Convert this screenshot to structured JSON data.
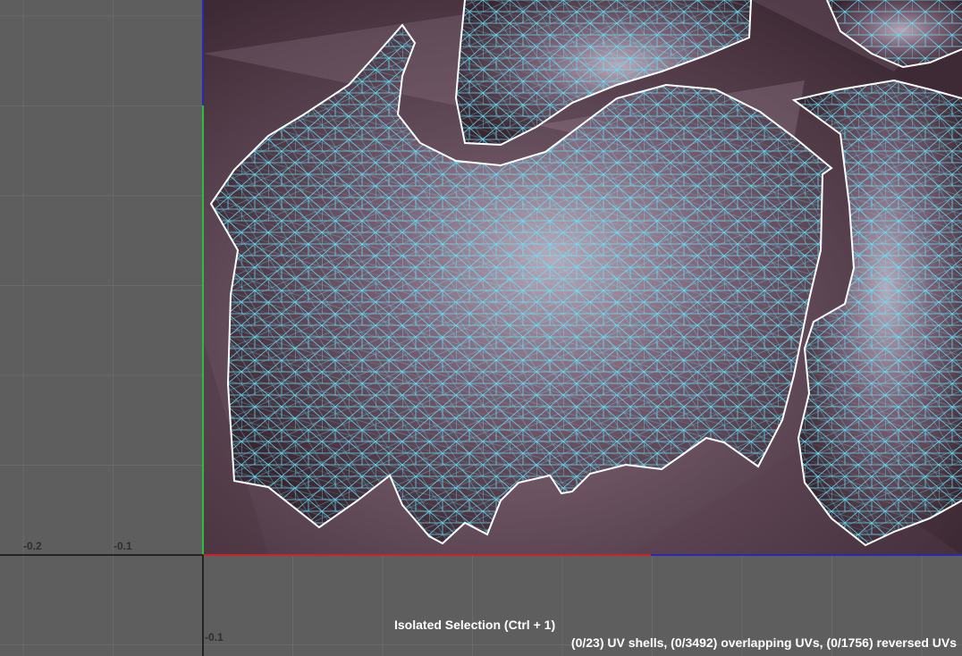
{
  "viewport": {
    "grid_color": "#6a6a6a",
    "background_color": "#5e5e5e",
    "axis_u_color": "#d0202a",
    "axis_v_color": "#2bbf3a",
    "texture_edge_color": "#2a2ab0",
    "shell_border_color": "#ffffff",
    "wire_color": "#64e6ff",
    "texture_color_dark": "#3b2630",
    "texture_color_mid": "#6e5565",
    "texture_color_light": "#b8a8b8"
  },
  "axis_labels": {
    "u_minus_02": "-0.2",
    "u_minus_01": "-0.1",
    "v_minus_01": "-0.1"
  },
  "status": {
    "isolate_hint": "Isolated Selection (Ctrl + 1)",
    "stats": "(0/23) UV shells, (0/3492) overlapping UVs, (0/1756) reversed UVs"
  }
}
